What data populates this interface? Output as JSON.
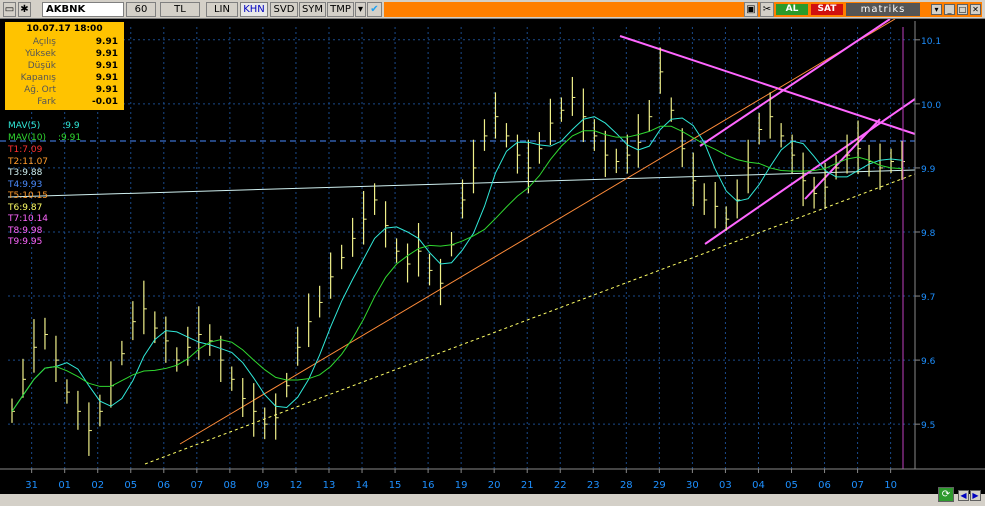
{
  "toolbar": {
    "symbol": "AKBNK",
    "period": "60",
    "currency": "TL",
    "lin": "LIN",
    "khn": "KHN",
    "svd": "SVD",
    "sym": "SYM",
    "tmp": "TMP",
    "al": "AL",
    "sat": "SAT",
    "brand": "matriks"
  },
  "info": {
    "date": "10.07.17 18:00",
    "rows": [
      {
        "label": "Açılış",
        "value": "9.91"
      },
      {
        "label": "Yüksek",
        "value": "9.91"
      },
      {
        "label": "Düşük",
        "value": "9.91"
      },
      {
        "label": "Kapanış",
        "value": "9.91"
      },
      {
        "label": "Ağ. Ort",
        "value": "9.91"
      },
      {
        "label": "Fark",
        "value": "-0.01"
      }
    ]
  },
  "indicators": {
    "mav5_label": "MAV(5)",
    "mav5_value": ":9.9",
    "mav10_label": "MAV(10)",
    "mav10_value": ":9.91"
  },
  "trendlines": [
    {
      "text": "T1:7.09",
      "color": "#ff3030"
    },
    {
      "text": "T2:11.07",
      "color": "#ff9a2a"
    },
    {
      "text": "T3:9.88",
      "color": "#d0f0f0"
    },
    {
      "text": "T4:9.93",
      "color": "#4a8cff"
    },
    {
      "text": "T5:10.15",
      "color": "#ff9a2a"
    },
    {
      "text": "T6:9.87",
      "color": "#ffff66"
    },
    {
      "text": "T7:10.14",
      "color": "#ff66ff"
    },
    {
      "text": "T8:9.98",
      "color": "#ff66ff"
    },
    {
      "text": "T9:9.95",
      "color": "#ff66ff"
    }
  ],
  "colors": {
    "bars": "#f0f08a",
    "mav5": "#30e8d8",
    "mav10": "#30d830",
    "grid": "#1a4a8a",
    "axis_text": "#1e90ff"
  },
  "chart_data": {
    "type": "line",
    "symbol": "AKBNK",
    "interval": "60",
    "x_labels": [
      "31",
      "01",
      "02",
      "05",
      "06",
      "07",
      "08",
      "09",
      "12",
      "13",
      "14",
      "15",
      "16",
      "19",
      "20",
      "21",
      "22",
      "23",
      "28",
      "29",
      "30",
      "03",
      "04",
      "05",
      "06",
      "07",
      "10"
    ],
    "y_ticks": [
      9.5,
      9.6,
      9.7,
      9.8,
      9.9,
      10.0,
      10.1
    ],
    "ylim": [
      9.43,
      10.12
    ],
    "series": [
      {
        "name": "AKBNK",
        "values": [
          9.52,
          9.57,
          9.62,
          9.64,
          9.6,
          9.55,
          9.52,
          9.49,
          9.52,
          9.56,
          9.61,
          9.66,
          9.68,
          9.65,
          9.63,
          9.6,
          9.62,
          9.64,
          9.63,
          9.6,
          9.57,
          9.54,
          9.52,
          9.5,
          9.51,
          9.56,
          9.62,
          9.66,
          9.69,
          9.73,
          9.76,
          9.79,
          9.82,
          9.85,
          9.81,
          9.77,
          9.75,
          9.77,
          9.74,
          9.72,
          9.78,
          9.85,
          9.9,
          9.95,
          9.98,
          9.95,
          9.92,
          9.9,
          9.93,
          9.97,
          9.99,
          10.01,
          9.98,
          9.95,
          9.92,
          9.91,
          9.92,
          9.94,
          9.98,
          10.05,
          9.99,
          9.93,
          9.88,
          9.85,
          9.84,
          9.82,
          9.85,
          9.9,
          9.96,
          9.98,
          9.95,
          9.92,
          9.88,
          9.86,
          9.87,
          9.9,
          9.92,
          9.93,
          9.91,
          9.9,
          9.91,
          9.91
        ]
      }
    ]
  }
}
